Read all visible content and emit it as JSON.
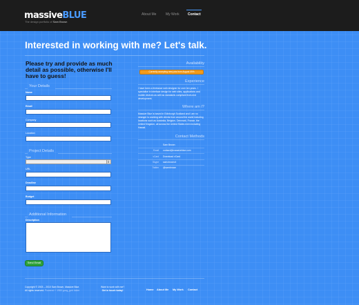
{
  "header": {
    "logo_part1": "massive",
    "logo_part2": "BLUE",
    "tagline_prefix": "The design portfolio of",
    "tagline_name": "Sam Brown",
    "nav": [
      {
        "label": "About Me"
      },
      {
        "label": "My Work"
      },
      {
        "label": "Contact"
      }
    ],
    "accent": "#4a9bff"
  },
  "main": {
    "heading": "Interested in working with me? Let's talk.",
    "intro": "Please try and provide as much detail as possible, otherwise I'll have to guess!"
  },
  "form": {
    "your_details": {
      "title": "Your Details",
      "name_label": "Name",
      "email_label": "Email",
      "company_label": "Company",
      "location_label": "Location"
    },
    "project_details": {
      "title": "Project Details",
      "type_label": "Type",
      "url_label": "URL",
      "deadline_label": "Deadline",
      "budget_label": "Budget"
    },
    "additional": {
      "title": "Additional Information",
      "description_label": "Description"
    },
    "send_label": "Send Email"
  },
  "sidebar": {
    "availability_title": "Availability",
    "availability_button": "Currently accepting new jobs from August 09%",
    "experience_title": "Experience",
    "experience_text": "I have been a freelance web designer for over ten years. I specialise in interface design for web sites, applications and mobile devices as well as standards compliant front-end development.",
    "where_title": "Where am I?",
    "where_text": "Massive Blue is based in Edinburgh Scotland and I am no stranger to working with clients from around the world including locations such as Australia, Belgium, Denmark, France, the United Kingdom, all across the United States even including Hawaii.",
    "contact_title": "Contact Methods",
    "contacts": [
      {
        "key": "",
        "value": "Sam Brown"
      },
      {
        "key": "Email",
        "value": "contact@massiveblue.com"
      },
      {
        "key": "vCard",
        "value": "Download vCard"
      },
      {
        "key": "Skype",
        "value": "sam.brown.it"
      },
      {
        "key": "Twitter",
        "value": "@sambrown"
      }
    ]
  },
  "footer": {
    "copyright": "Copyright © 2003 – 2010 Sam Brown, Massive Blue.",
    "rights": "All rights reserved.",
    "rights_dim": "Powered + 1980 goog_gnb folder",
    "cta_line1": "Want to work with me?",
    "cta_line2": "Get in touch today!",
    "links": [
      {
        "label": "Home"
      },
      {
        "label": "About Me"
      },
      {
        "label": "My Work"
      },
      {
        "label": "Contact"
      }
    ]
  }
}
